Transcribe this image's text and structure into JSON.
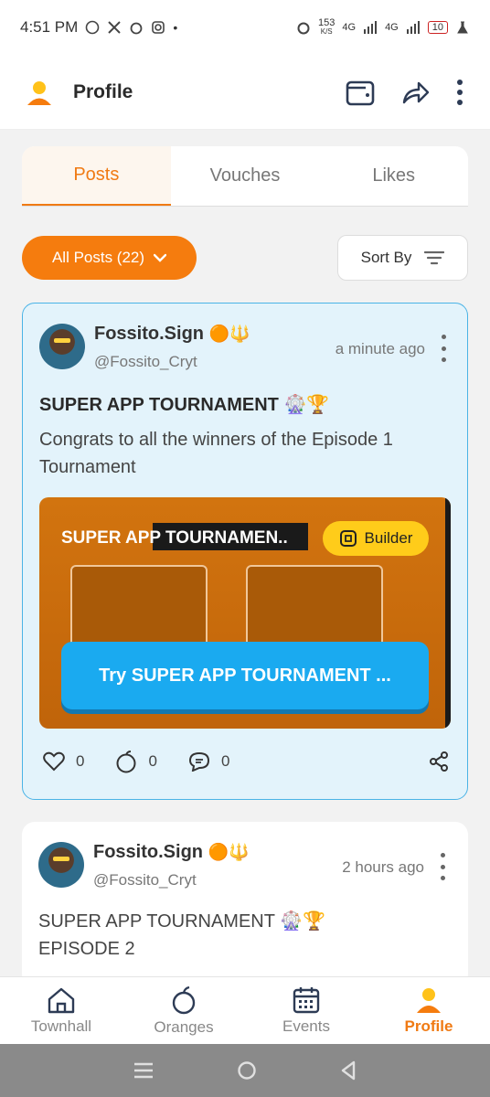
{
  "status_bar": {
    "time": "4:51 PM",
    "net_speed": "153",
    "net_unit": "K/S",
    "net1": "4G",
    "net2": "4G",
    "battery": "10"
  },
  "header": {
    "title": "Profile",
    "icons": [
      "avatar-icon",
      "wallet-icon",
      "share-icon",
      "more-icon"
    ]
  },
  "tabs": [
    {
      "label": "Posts",
      "active": true
    },
    {
      "label": "Vouches",
      "active": false
    },
    {
      "label": "Likes",
      "active": false
    }
  ],
  "filter": {
    "label": "All Posts (22)"
  },
  "sort": {
    "label": "Sort By"
  },
  "posts": [
    {
      "username": "Fossito.Sign",
      "badges": "🟠🔱",
      "handle": "@Fossito_Cryt",
      "time": "a minute ago",
      "title": "SUPER APP TOURNAMENT 🎡🏆",
      "body": "Congrats to all the winners of the Episode 1 Tournament",
      "media": {
        "title": "SUPER APP TOURNAMEN..",
        "badge": "Builder",
        "cta": "Try SUPER APP TOURNAMENT ..."
      },
      "likes": "0",
      "oranges": "0",
      "comments": "0"
    },
    {
      "username": "Fossito.Sign",
      "badges": "🟠🔱",
      "handle": "@Fossito_Cryt",
      "time": "2 hours ago",
      "title": "SUPER APP TOURNAMENT 🎡🏆",
      "subtitle": "EPISODE 2"
    }
  ],
  "bottom_nav": [
    {
      "label": "Townhall",
      "icon": "home-icon"
    },
    {
      "label": "Oranges",
      "icon": "orange-icon"
    },
    {
      "label": "Events",
      "icon": "calendar-icon"
    },
    {
      "label": "Profile",
      "icon": "profile-icon",
      "active": true
    }
  ],
  "colors": {
    "accent": "#f57c0e",
    "highlight_border": "#4ab3e6",
    "cta": "#1aaaf0",
    "builder": "#ffcc1a"
  }
}
